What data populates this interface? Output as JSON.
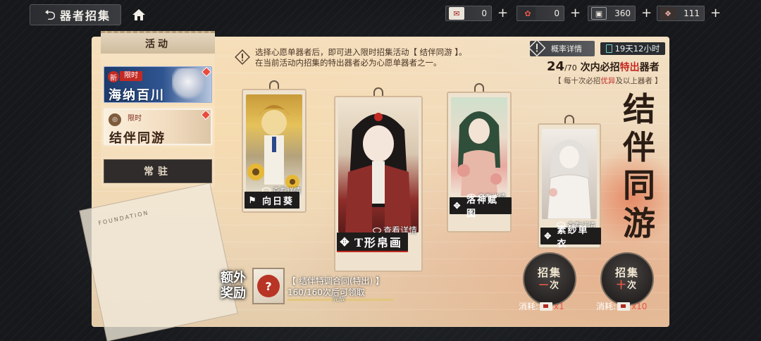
{
  "header": {
    "back_icon": "back-arrow-icon",
    "title": "器者招集",
    "home_icon": "home-icon"
  },
  "resources": [
    {
      "icon": "red-letter-icon",
      "value": "0"
    },
    {
      "icon": "coin-sack-icon",
      "value": "0"
    },
    {
      "icon": "ticket-icon",
      "value": "360"
    },
    {
      "icon": "crystal-icon",
      "value": "111"
    }
  ],
  "sidebar": {
    "header": "活动",
    "items": [
      {
        "new_tag": "新",
        "limited": "限时",
        "title": "海纳百川"
      },
      {
        "limited": "限时",
        "title": "结伴同游"
      }
    ],
    "regular": "常驻"
  },
  "notice": {
    "line1": "选择心愿单器者后，即可进入限时招集活动【 结伴同游 】。",
    "line2": "在当前活动内招集的特出器者必为心愿单器者之一。"
  },
  "rate_details": "概率详情",
  "timer": "19天12小时",
  "pity": {
    "count": "24",
    "total": "/70",
    "text_a": "次内必招",
    "text_red": "特出",
    "text_b": "器者"
  },
  "pity_sub": {
    "a": "【 每十次必招",
    "red": "优异",
    "b": "及以上器者 】"
  },
  "banner_title": [
    "结",
    "伴",
    "同",
    "游"
  ],
  "cards": [
    {
      "name": "向日葵",
      "detail": "查看详情",
      "name_icon": "flag-icon"
    },
    {
      "name": "T形帛画",
      "detail": "查看详情",
      "name_icon": "knot-icon"
    },
    {
      "name": "洛神赋图",
      "detail": "查看详情",
      "name_icon": "knot-icon"
    },
    {
      "name": "素纱单衣",
      "detail": "查看详情",
      "name_icon": "knot-icon"
    }
  ],
  "bonus": {
    "label1": "额外",
    "label2": "奖励",
    "item_name": "【 结伴特调合同(特出) 】",
    "progress": "160/160次后可领取",
    "done": "完成"
  },
  "pull_one": {
    "l1": "招集",
    "l2_a": "一",
    "l2_b": "次",
    "cost_label": "消耗:",
    "cost_mult": "x1"
  },
  "pull_ten": {
    "l1": "招集",
    "l2_a": "十",
    "l2_b": "次",
    "cost_label": "消耗:",
    "cost_mult": "x10"
  }
}
